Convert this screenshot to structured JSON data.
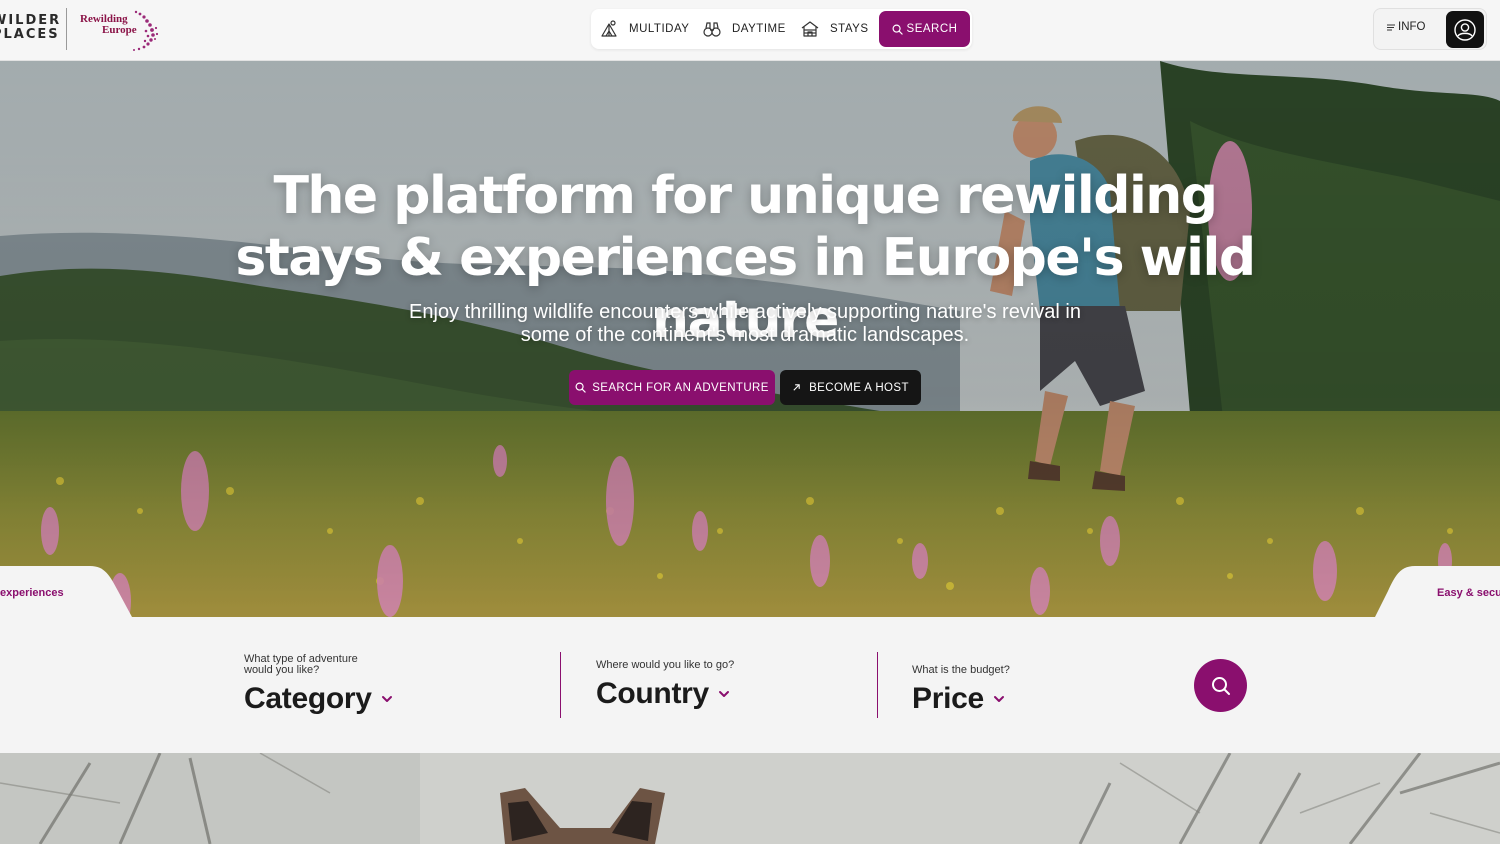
{
  "header": {
    "logo_wilder": "WILDER",
    "logo_places": "PLACES",
    "partner_logo_line1": "Rewilding",
    "partner_logo_line2": "Europe",
    "nav": {
      "multiday": "MULTIDAY",
      "daytime": "DAYTIME",
      "stays": "STAYS",
      "search": "SEARCH"
    },
    "info": "INFO"
  },
  "hero": {
    "title": "The platform for unique rewilding stays & experiences in Europe's wild nature",
    "subtitle": "Enjoy thrilling wildlife encounters while actively supporting nature's revival in some of the continent's most dramatic landscapes.",
    "btn_adventure": "SEARCH FOR AN ADVENTURE",
    "btn_host": "BECOME A HOST",
    "tab_left": "experiences",
    "tab_right": "Easy & secu"
  },
  "search": {
    "category": {
      "label": "What type of adventure would you like?",
      "value": "Category"
    },
    "country": {
      "label": "Where would you like to go?",
      "value": "Country"
    },
    "price": {
      "label": "What is the budget?",
      "value": "Price"
    }
  },
  "colors": {
    "accent": "#8a0f6e",
    "dark_button": "#151515",
    "header_bg": "#f6f6f6",
    "search_bg": "#f4f4f4"
  },
  "icons": {
    "multiday": "tent-person-icon",
    "daytime": "binoculars-icon",
    "stays": "cabin-icon",
    "search": "search-icon",
    "info": "menu-lines-icon",
    "avatar": "user-avatar-icon",
    "host": "arrow-up-right-icon",
    "dropdown": "chevron-down-icon"
  }
}
